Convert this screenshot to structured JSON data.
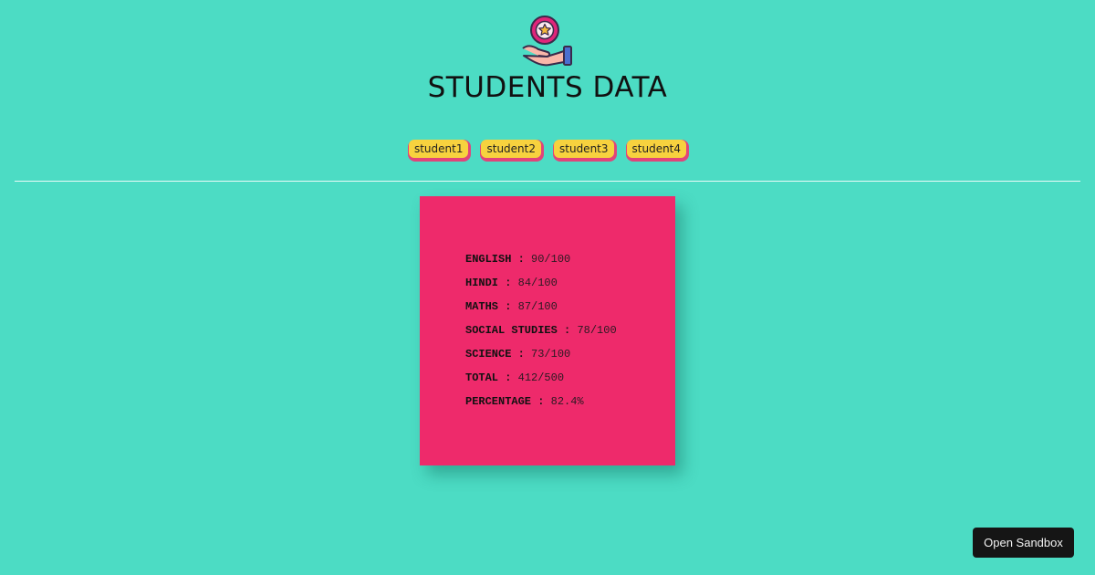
{
  "header": {
    "title": "STUDENTS DATA",
    "logo_icon": "hand-holding-star-coin-icon"
  },
  "nav": {
    "items": [
      {
        "label": "student1"
      },
      {
        "label": "student2"
      },
      {
        "label": "student3"
      },
      {
        "label": "student4"
      }
    ]
  },
  "card": {
    "rows": [
      {
        "subject": "ENGLISH",
        "separator": " : ",
        "score": "90/100"
      },
      {
        "subject": "HINDI",
        "separator": " : ",
        "score": "84/100"
      },
      {
        "subject": "MATHS",
        "separator": " : ",
        "score": "87/100"
      },
      {
        "subject": "SOCIAL STUDIES",
        "separator": " : ",
        "score": "78/100"
      },
      {
        "subject": "SCIENCE",
        "separator": " : ",
        "score": "73/100"
      },
      {
        "subject": "TOTAL",
        "separator": " : ",
        "score": "412/500"
      },
      {
        "subject": "PERCENTAGE",
        "separator": " : ",
        "score": "82.4%"
      }
    ]
  },
  "footer": {
    "sandbox_label": "Open Sandbox"
  },
  "colors": {
    "background": "#4cdcc4",
    "card": "#ee2a6b",
    "button": "#f7d23e",
    "button_shadow": "#e0447a"
  }
}
